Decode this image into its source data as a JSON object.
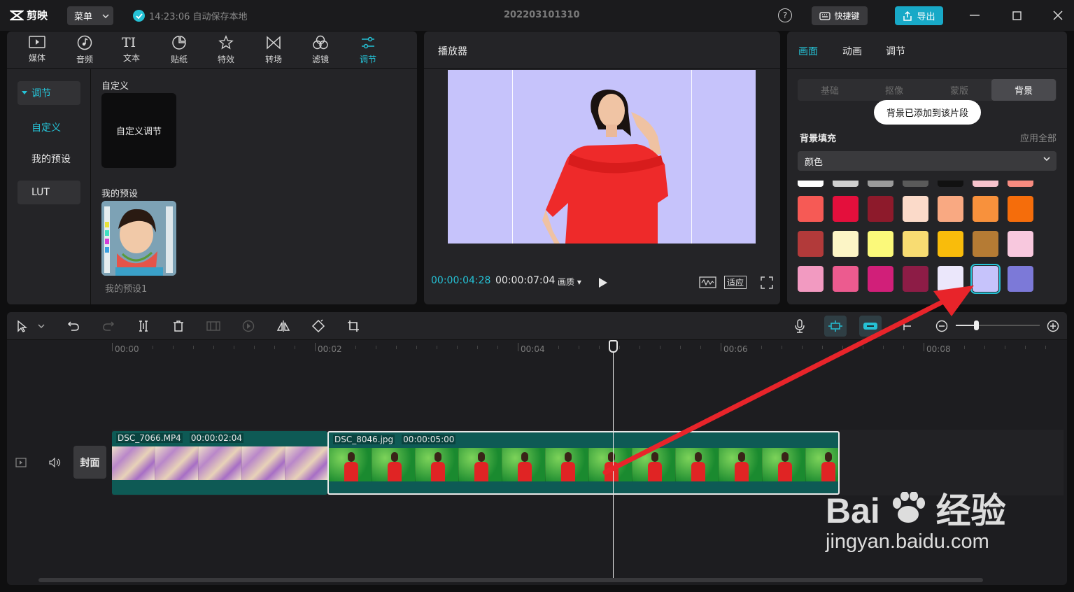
{
  "app": {
    "name": "剪映",
    "menu_label": "菜单",
    "autosave_text": "14:23:06 自动保存本地",
    "project_name": "202203101310",
    "help": "?",
    "shortcut_label": "快捷键",
    "export_label": "导出"
  },
  "tools": [
    {
      "label": "媒体",
      "icon": "media-icon"
    },
    {
      "label": "音频",
      "icon": "audio-icon"
    },
    {
      "label": "文本",
      "icon": "text-icon"
    },
    {
      "label": "贴纸",
      "icon": "sticker-icon"
    },
    {
      "label": "特效",
      "icon": "effects-icon"
    },
    {
      "label": "转场",
      "icon": "transition-icon"
    },
    {
      "label": "滤镜",
      "icon": "filter-icon"
    },
    {
      "label": "调节",
      "icon": "adjust-icon",
      "active": true
    }
  ],
  "adjust_nav": {
    "group": "调节",
    "items": [
      "自定义",
      "我的预设",
      "LUT"
    ]
  },
  "adjust_content": {
    "custom_title": "自定义",
    "custom_card": "自定义调节",
    "preset_title": "我的预设",
    "preset_name": "我的预设1"
  },
  "player": {
    "title": "播放器",
    "current_time": "00:00:04:28",
    "total_time": "00:00:07:04",
    "quality": "画质",
    "fit_label": "适应"
  },
  "inspector": {
    "tabs": [
      "画面",
      "动画",
      "调节"
    ],
    "subtabs": [
      "基础",
      "抠像",
      "蒙版",
      "背景"
    ],
    "tooltip": "背景已添加到该片段",
    "fill_title": "背景填充",
    "apply_all": "应用全部",
    "fill_type": "颜色",
    "swatches": [
      [
        "#ffffff",
        "#cfcfcf",
        "#9a9a9a",
        "#5a5a5a",
        "#111111",
        "#f6c3cc",
        "#f78b80"
      ],
      [
        "#f65a55",
        "#e40f3c",
        "#8d1a2b",
        "#fbdac9",
        "#f9a982",
        "#f8913c",
        "#f56d0b"
      ],
      [
        "#b23a3a",
        "#fcf5c6",
        "#fbf97a",
        "#f8dc72",
        "#f9bc0b",
        "#b57b34",
        "#f8c8de"
      ],
      [
        "#f29ac1",
        "#ec5b8f",
        "#d11f79",
        "#8d1c46",
        "#ebe7fb",
        "#c6c3fb",
        "#7c79d8"
      ]
    ],
    "selected_swatch": "#c6c3fb"
  },
  "timeline": {
    "ruler": [
      "00:00",
      "00:02",
      "00:04",
      "00:06",
      "00:08"
    ],
    "cover_label": "封面",
    "clips": [
      {
        "name": "DSC_7066.MP4",
        "duration": "00:00:02:04"
      },
      {
        "name": "DSC_8046.jpg",
        "duration": "00:00:05:00"
      }
    ]
  },
  "watermark": {
    "brand": "Bai",
    "brand_suffix": "经验",
    "url": "jingyan.baidu.com"
  }
}
